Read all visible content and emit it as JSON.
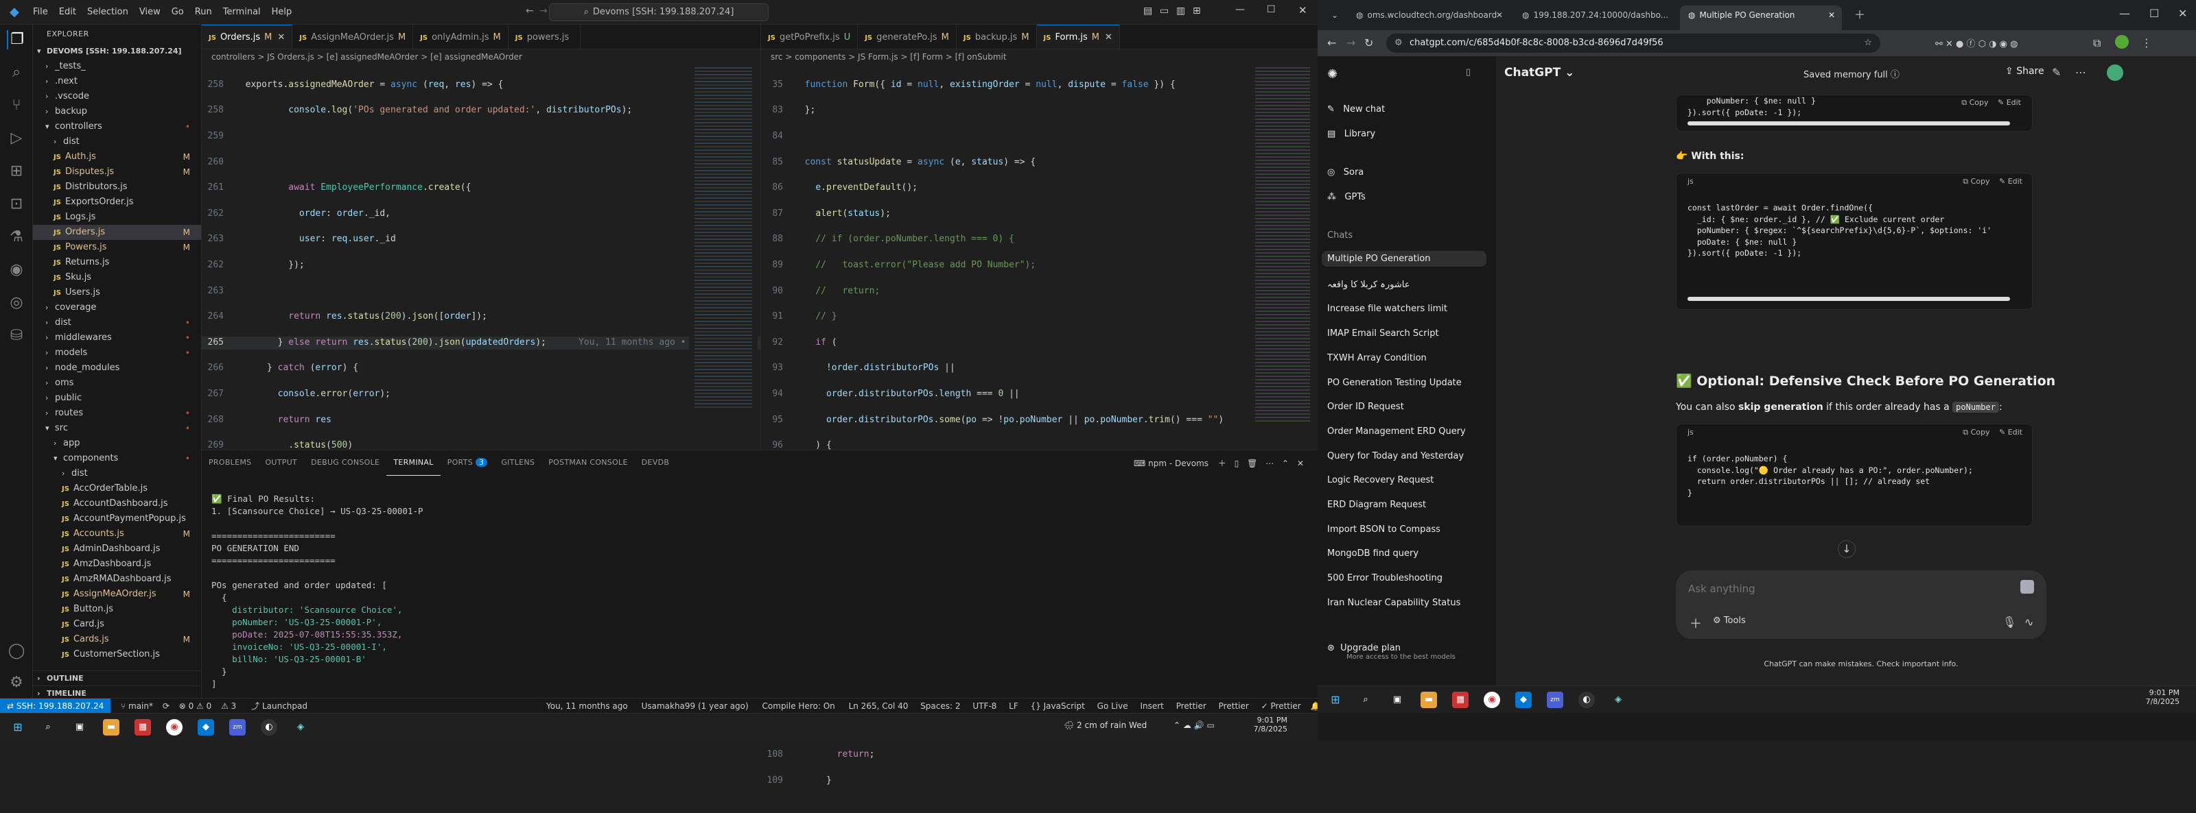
{
  "vscode": {
    "menu": [
      "File",
      "Edit",
      "Selection",
      "View",
      "Go",
      "Run",
      "Terminal",
      "Help"
    ],
    "command_center": "Devoms [SSH: 199.188.207.24]",
    "explorer": {
      "title": "EXPLORER",
      "root": "DEVOMS [SSH: 199.188.207.24]",
      "items": [
        {
          "label": "_tests_",
          "indent": 1,
          "kind": "folder",
          "badge": ""
        },
        {
          "label": ".next",
          "indent": 1,
          "kind": "folder",
          "badge": ""
        },
        {
          "label": ".vscode",
          "indent": 1,
          "kind": "folder",
          "badge": ""
        },
        {
          "label": "backup",
          "indent": 1,
          "kind": "folder",
          "badge": ""
        },
        {
          "label": "controllers",
          "indent": 1,
          "kind": "folder-open",
          "badge": "•"
        },
        {
          "label": "dist",
          "indent": 2,
          "kind": "folder",
          "badge": ""
        },
        {
          "label": "Auth.js",
          "indent": 2,
          "kind": "js",
          "badge": "M"
        },
        {
          "label": "Disputes.js",
          "indent": 2,
          "kind": "js",
          "badge": "M"
        },
        {
          "label": "Distributors.js",
          "indent": 2,
          "kind": "js",
          "badge": ""
        },
        {
          "label": "ExportsOrder.js",
          "indent": 2,
          "kind": "js",
          "badge": ""
        },
        {
          "label": "Logs.js",
          "indent": 2,
          "kind": "js",
          "badge": ""
        },
        {
          "label": "Orders.js",
          "indent": 2,
          "kind": "js",
          "badge": "M",
          "selected": true
        },
        {
          "label": "Powers.js",
          "indent": 2,
          "kind": "js",
          "badge": "M"
        },
        {
          "label": "Returns.js",
          "indent": 2,
          "kind": "js",
          "badge": ""
        },
        {
          "label": "Sku.js",
          "indent": 2,
          "kind": "js",
          "badge": ""
        },
        {
          "label": "Users.js",
          "indent": 2,
          "kind": "js",
          "badge": ""
        },
        {
          "label": "coverage",
          "indent": 1,
          "kind": "folder",
          "badge": ""
        },
        {
          "label": "dist",
          "indent": 1,
          "kind": "folder",
          "badge": "•"
        },
        {
          "label": "middlewares",
          "indent": 1,
          "kind": "folder",
          "badge": "•"
        },
        {
          "label": "models",
          "indent": 1,
          "kind": "folder",
          "badge": "•"
        },
        {
          "label": "node_modules",
          "indent": 1,
          "kind": "folder",
          "badge": ""
        },
        {
          "label": "oms",
          "indent": 1,
          "kind": "folder",
          "badge": ""
        },
        {
          "label": "public",
          "indent": 1,
          "kind": "folder",
          "badge": ""
        },
        {
          "label": "routes",
          "indent": 1,
          "kind": "folder",
          "badge": "•"
        },
        {
          "label": "src",
          "indent": 1,
          "kind": "folder-open",
          "badge": "•"
        },
        {
          "label": "app",
          "indent": 2,
          "kind": "folder",
          "badge": ""
        },
        {
          "label": "components",
          "indent": 2,
          "kind": "folder-open",
          "badge": "•"
        },
        {
          "label": "dist",
          "indent": 3,
          "kind": "folder",
          "badge": ""
        },
        {
          "label": "AccOrderTable.js",
          "indent": 3,
          "kind": "js",
          "badge": ""
        },
        {
          "label": "AccountDashboard.js",
          "indent": 3,
          "kind": "js",
          "badge": ""
        },
        {
          "label": "AccountPaymentPopup.js",
          "indent": 3,
          "kind": "js",
          "badge": ""
        },
        {
          "label": "Accounts.js",
          "indent": 3,
          "kind": "js",
          "badge": "M"
        },
        {
          "label": "AdminDashboard.js",
          "indent": 3,
          "kind": "js",
          "badge": ""
        },
        {
          "label": "AmzDashboard.js",
          "indent": 3,
          "kind": "js",
          "badge": ""
        },
        {
          "label": "AmzRMADashboard.js",
          "indent": 3,
          "kind": "js",
          "badge": ""
        },
        {
          "label": "AssignMeAOrder.js",
          "indent": 3,
          "kind": "js",
          "badge": "M"
        },
        {
          "label": "Button.js",
          "indent": 3,
          "kind": "js",
          "badge": ""
        },
        {
          "label": "Card.js",
          "indent": 3,
          "kind": "js",
          "badge": ""
        },
        {
          "label": "Cards.js",
          "indent": 3,
          "kind": "js",
          "badge": "M"
        },
        {
          "label": "CustomerSection.js",
          "indent": 3,
          "kind": "js",
          "badge": ""
        }
      ],
      "outline": "OUTLINE",
      "timeline": "TIMELINE"
    },
    "left_editor": {
      "tabs": [
        {
          "label": "Orders.js",
          "mod": "M",
          "active": true
        },
        {
          "label": "AssignMeAOrder.js",
          "mod": "M",
          "active": false
        },
        {
          "label": "onlyAdmin.js",
          "mod": "M",
          "active": false
        },
        {
          "label": "powers.js",
          "mod": "",
          "active": false
        }
      ],
      "breadcrumb": "controllers > JS Orders.js > [e] assignedMeAOrder > [e] assignedMeAOrder",
      "blame": "You, 11 months ago •"
    },
    "right_editor": {
      "tabs": [
        {
          "label": "getPoPrefix.js",
          "mod": "U",
          "active": false
        },
        {
          "label": "generatePo.js",
          "mod": "M",
          "active": false
        },
        {
          "label": "backup.js",
          "mod": "M",
          "active": false
        },
        {
          "label": "Form.js",
          "mod": "M",
          "active": true
        }
      ],
      "breadcrumb": "src > components > JS Form.js > [f] Form > [f] onSubmit"
    },
    "panel": {
      "tabs": [
        "PROBLEMS",
        "OUTPUT",
        "DEBUG CONSOLE",
        "TERMINAL",
        "PORTS",
        "GITLENS",
        "POSTMAN CONSOLE",
        "DEVDB"
      ],
      "active_tab": "TERMINAL",
      "ports_count": "3",
      "terminal_name": "npm - Devoms",
      "terminal_lines": [
        "",
        "✅ Final PO Results:",
        "1. [Scansource Choice] → US-Q3-25-00001-P",
        "",
        "========================",
        "PO GENERATION END",
        "========================",
        "",
        "POs generated and order updated: [",
        "  {",
        "    distributor: 'Scansource Choice',",
        "    poNumber: 'US-Q3-25-00001-P',",
        "    poDate: 2025-07-08T15:55:35.353Z,",
        "    invoiceNo: 'US-Q3-25-00001-I',",
        "    billNo: 'US-Q3-25-00001-B'",
        "  }",
        "]",
        ""
      ]
    },
    "statusbar": {
      "remote": "SSH: 199.188.207.24",
      "branch": "main*",
      "sync": "⟳",
      "errors": "⊗ 0 ⚠ 0",
      "warnings": "⚠ 3",
      "launchpad": "Launchpad",
      "blame": "You, 11 months ago",
      "user": "Usamakha99 (1 year ago)",
      "compile": "Compile Hero: On",
      "position": "Ln 265, Col 40",
      "spaces": "Spaces: 2",
      "encoding": "UTF-8",
      "eol": "LF",
      "language": "{} JavaScript",
      "golive": "Go Live",
      "insert": "Insert",
      "prettier1": "Prettier",
      "prettier2": "Prettier",
      "prettier3": "✓ Prettier"
    },
    "taskbar": {
      "weather": "2 cm of rain Wed",
      "time": "9:01 PM",
      "date": "7/8/2025"
    }
  },
  "chrome": {
    "tabs": [
      {
        "label": "oms.wcloudtech.org/dashboard",
        "active": false
      },
      {
        "label": "199.188.207.24:10000/dashbo...",
        "active": false
      },
      {
        "label": "Multiple PO Generation",
        "active": true
      }
    ],
    "url": "chatgpt.com/c/685d4b0f-8c8c-8008-b3cd-8696d7d49f56",
    "sidebar": {
      "new_chat": "New chat",
      "library": "Library",
      "sora": "Sora",
      "gpts": "GPTs",
      "chats_header": "Chats",
      "chats": [
        "Multiple PO Generation",
        "عاشورہ کربلا کا واقعہ",
        "Increase file watchers limit",
        "IMAP Email Search Script",
        "TXWH Array Condition",
        "PO Generation Testing Update",
        "Order ID Request",
        "Order Management ERD Query",
        "Query for Today and Yesterday",
        "Logic Recovery Request",
        "ERD Diagram Request",
        "Import BSON to Compass",
        "MongoDB find query",
        "500 Error Troubleshooting",
        "Iran Nuclear Capability Status"
      ],
      "upgrade_title": "Upgrade plan",
      "upgrade_sub": "More access to the best models"
    },
    "main": {
      "model": "ChatGPT",
      "memory": "Saved memory full",
      "share": "Share",
      "with_this": "With this:",
      "copy": "Copy",
      "edit": "Edit",
      "lang": "js",
      "code1_lines": [
        "    poNumber: { $ne: null }",
        "}).sort({ poDate: -1 });"
      ],
      "code2_lines": [
        "const lastOrder = await Order.findOne({",
        "  _id: { $ne: order._id }, // ✅ Exclude current order",
        "  poNumber: { $regex: `^${searchPrefix}\\d{5,6}-P`, $options: 'i'",
        "  poDate: { $ne: null }",
        "}).sort({ poDate: -1 });"
      ],
      "heading": "✅ Optional: Defensive Check Before PO Generation",
      "para_pre": "You can also ",
      "para_bold": "skip generation",
      "para_mid": " if this order already has a ",
      "para_code": "poNumber",
      "para_end": ":",
      "code3_lines": [
        "if (order.poNumber) {",
        "  console.log(\"🟡 Order already has a PO:\", order.poNumber);",
        "  return order.distributorPOs || []; // already set",
        "}"
      ],
      "input_placeholder": "Ask anything",
      "tools": "Tools",
      "disclaimer": "ChatGPT can make mistakes. Check important info."
    },
    "taskbar": {
      "time": "9:01 PM",
      "date": "7/8/2025"
    }
  }
}
